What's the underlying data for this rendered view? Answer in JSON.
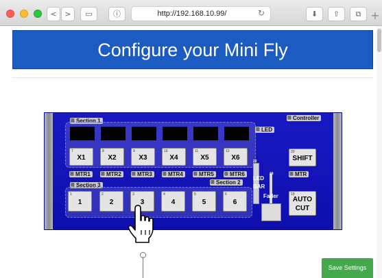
{
  "browser": {
    "url": "http://192.168.10.99/",
    "back_glyph": "<",
    "forward_glyph": ">",
    "sidebar_glyph": "▭",
    "info_glyph": "ⓘ",
    "reload_glyph": "↻",
    "download_glyph": "⬇",
    "share_glyph": "⇧",
    "tabs_glyph": "⧉",
    "new_tab_glyph": "+"
  },
  "page": {
    "title": "Configure your Mini Fly",
    "save_label": "Save Settings"
  },
  "panel": {
    "section1_label": "Section 1",
    "section2_label": "Section 2",
    "section3_label": "Section 3",
    "controller_label": "Controller",
    "led_label": "LED",
    "led_bar_label1": "LED",
    "led_bar_label2": "BAR",
    "fader_label": "Fader",
    "ledbar_num": "22",
    "fader_num": "23",
    "keys_top": [
      {
        "num": "7",
        "label": "X1"
      },
      {
        "num": "8",
        "label": "X2"
      },
      {
        "num": "9",
        "label": "X3"
      },
      {
        "num": "10",
        "label": "X4"
      },
      {
        "num": "11",
        "label": "X5"
      },
      {
        "num": "12",
        "label": "X6"
      }
    ],
    "mtr_top": [
      "MTR1",
      "MTR2",
      "MTR3",
      "MTR4",
      "MTR5",
      "MTR6"
    ],
    "keys_bottom": [
      {
        "num": "1",
        "label": "1"
      },
      {
        "num": "2",
        "label": "2"
      },
      {
        "num": "3",
        "label": "3"
      },
      {
        "num": "4",
        "label": "4"
      },
      {
        "num": "5",
        "label": "5"
      },
      {
        "num": "6",
        "label": "6"
      }
    ],
    "shift": {
      "num": "20",
      "label": "SHIFT"
    },
    "mtr_right": "MTR",
    "auto_cut": {
      "num": "19",
      "label1": "AUTO",
      "label2": "CUT"
    }
  },
  "colors": {
    "banner": "#1c5bc2",
    "panel": "#1414bb",
    "save_button": "#46a84d"
  }
}
